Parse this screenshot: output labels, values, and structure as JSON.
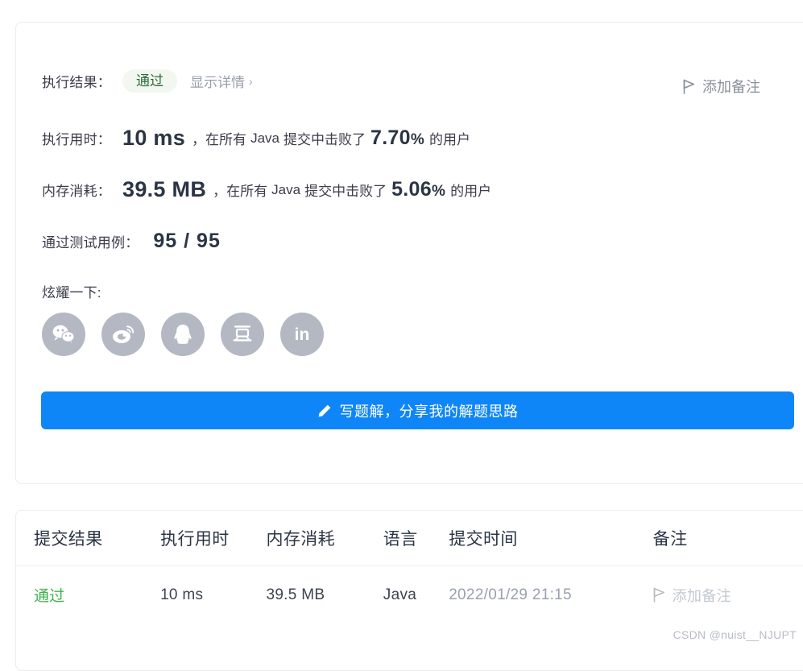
{
  "result_card": {
    "result_label": "执行结果：",
    "status_badge": "通过",
    "detail_link": "显示详情",
    "detail_chevron": "›",
    "add_note": "添加备注",
    "runtime": {
      "label": "执行用时：",
      "value": "10 ms",
      "separator": "，在所有",
      "language": "Java",
      "beats_prefix": "提交中击败了",
      "percent": "7.70",
      "percent_symbol": "%",
      "suffix": "的用户"
    },
    "memory": {
      "label": "内存消耗：",
      "value": "39.5 MB",
      "separator": "，在所有",
      "language": "Java",
      "beats_prefix": "提交中击败了",
      "percent": "5.06",
      "percent_symbol": "%",
      "suffix": "的用户"
    },
    "testcases": {
      "label": "通过测试用例：",
      "value": "95 / 95"
    },
    "share": {
      "label": "炫耀一下:",
      "icons": [
        {
          "name": "wechat-share-icon",
          "glyph": ""
        },
        {
          "name": "weibo-share-icon",
          "glyph": ""
        },
        {
          "name": "qq-share-icon",
          "glyph": ""
        },
        {
          "name": "douban-share-icon",
          "glyph": "豆"
        },
        {
          "name": "linkedin-share-icon",
          "glyph": "in"
        }
      ]
    },
    "write_solution_button": "写题解，分享我的解题思路"
  },
  "submissions_table": {
    "headers": [
      "提交结果",
      "执行用时",
      "内存消耗",
      "语言",
      "提交时间",
      "备注"
    ],
    "rows": [
      {
        "verdict": "通过",
        "runtime": "10 ms",
        "memory": "39.5 MB",
        "language": "Java",
        "submitted_at": "2022/01/29 21:15",
        "note": "添加备注"
      }
    ]
  },
  "watermark": "CSDN @nuist__NJUPT",
  "colors": {
    "accent_blue": "#0e86f7",
    "pass_green": "#3cb44a",
    "badge_bg": "#f2f8ef",
    "badge_text": "#2d6a3e",
    "social_gray": "#b3b8c3"
  }
}
